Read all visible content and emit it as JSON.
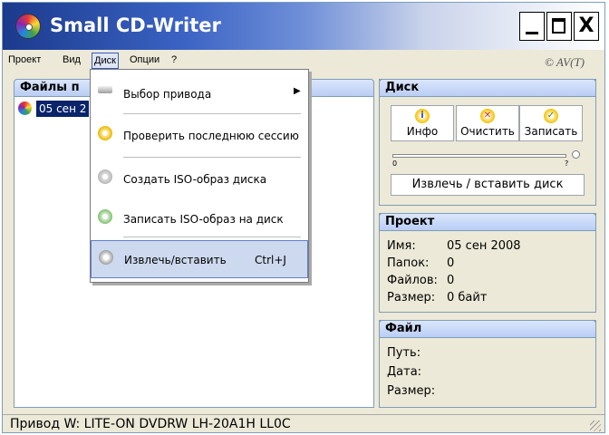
{
  "window": {
    "title": "Small CD-Writer",
    "brand": "© AV(T)"
  },
  "title_buttons": {
    "minimize": "_",
    "maximize": "□",
    "close": "X"
  },
  "menubar": {
    "items": [
      "Проект",
      "Вид",
      "Диск",
      "Опции",
      "?"
    ],
    "active": "Диск"
  },
  "left_panel": {
    "title": "Файлы п",
    "items": [
      {
        "label": "05 сен 2",
        "selected": true
      }
    ]
  },
  "disk_panel": {
    "title": "Диск",
    "buttons": [
      {
        "label": "Инфо",
        "icon": "info-disc-icon"
      },
      {
        "label": "Очистить",
        "icon": "erase-disc-icon"
      },
      {
        "label": "Записать",
        "icon": "burn-disc-icon"
      }
    ],
    "slider": {
      "min_label": "0",
      "max_label": "?"
    },
    "eject_label": "Извлечь / вставить диск"
  },
  "project_panel": {
    "title": "Проект",
    "rows": [
      {
        "key": "Имя:",
        "value": "05 сен 2008"
      },
      {
        "key": "Папок:",
        "value": "0"
      },
      {
        "key": "Файлов:",
        "value": "0"
      },
      {
        "key": "Размер:",
        "value": "0 байт"
      }
    ]
  },
  "file_panel": {
    "title": "Файл",
    "rows": [
      {
        "key": "Путь:",
        "value": ""
      },
      {
        "key": "Дата:",
        "value": ""
      },
      {
        "key": "Размер:",
        "value": ""
      }
    ]
  },
  "dropdown": {
    "items": [
      {
        "label": "Выбор привода",
        "icon": "drive-icon",
        "submenu": true
      },
      {
        "label": "Проверить последнюю сессию",
        "icon": "check-disc-icon"
      },
      {
        "label": "Создать ISO-образ диска",
        "icon": "disc-image-icon"
      },
      {
        "label": "Записать ISO-образ на диск",
        "icon": "write-image-icon"
      },
      {
        "label": "Извлечь/вставить",
        "icon": "eject-icon",
        "shortcut": "Ctrl+J",
        "highlighted": true
      }
    ]
  },
  "statusbar": {
    "text": "Привод W: LITE-ON DVDRW LH-20A1H LL0C"
  }
}
